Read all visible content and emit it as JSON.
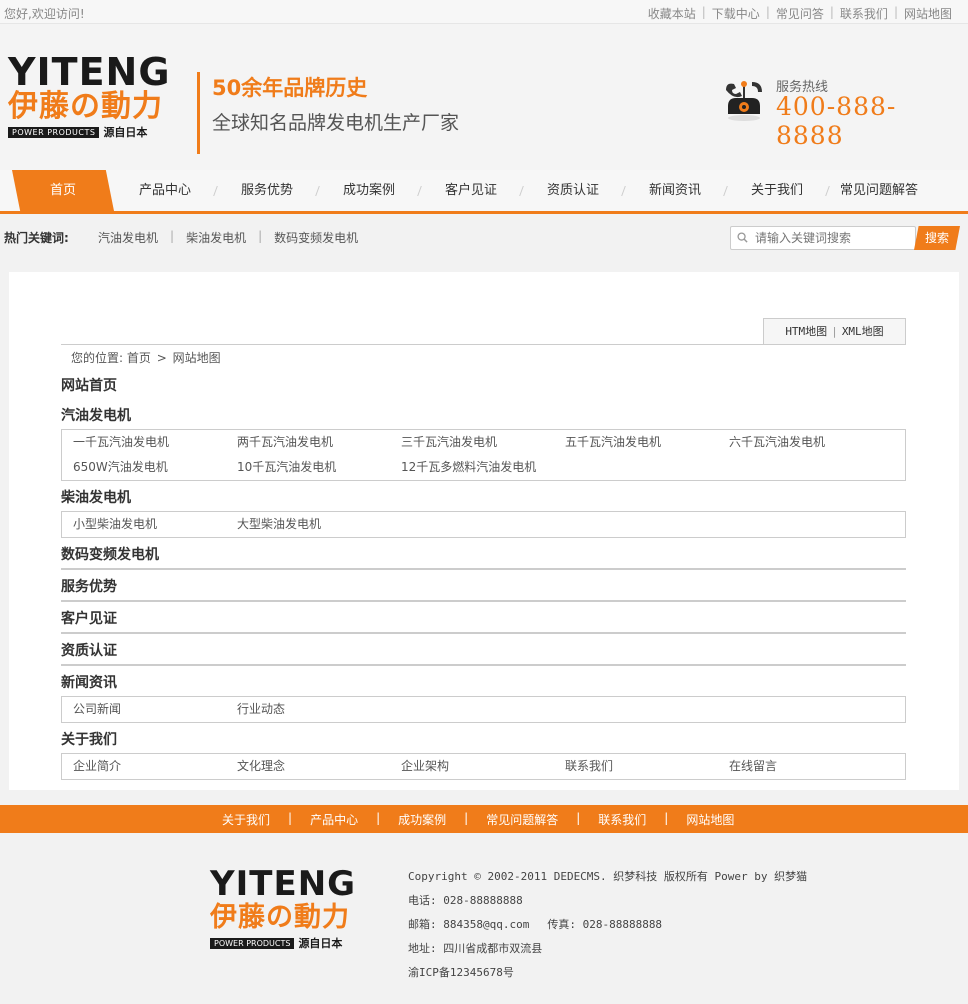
{
  "topbar": {
    "welcome": "您好,欢迎访问!",
    "links": [
      "收藏本站",
      "下载中心",
      "常见问答",
      "联系我们",
      "网站地图"
    ]
  },
  "brand": {
    "line1": "YITENG",
    "line2": "伊藤の動力",
    "power_products": "POWER PRODUCTS",
    "origin": "源自日本",
    "primary_color": "#f07c1a"
  },
  "slogan": {
    "line1": "50余年品牌历史",
    "line2": "全球知名品牌发电机生产厂家"
  },
  "hotline": {
    "label": "服务热线",
    "number": "400-888-8888",
    "icon": "telephone-icon"
  },
  "nav": {
    "items": [
      "首页",
      "产品中心",
      "服务优势",
      "成功案例",
      "客户见证",
      "资质认证",
      "新闻资讯",
      "关于我们",
      "常见问题解答"
    ],
    "active_index": 0
  },
  "keywords": {
    "title": "热门关键词:",
    "words": [
      "汽油发电机",
      "柴油发电机",
      "数码变频发电机"
    ]
  },
  "search": {
    "placeholder": "请输入关键词搜索",
    "button": "搜索"
  },
  "map_buttons": [
    "HTM地图",
    "XML地图"
  ],
  "breadcrumb": {
    "prefix": "您的位置:",
    "home": "首页",
    "arrow": ">",
    "current": "网站地图"
  },
  "sitemap": {
    "home": "网站首页",
    "sections": [
      {
        "title": "汽油发电机",
        "links": [
          "一千瓦汽油发电机",
          "两千瓦汽油发电机",
          "三千瓦汽油发电机",
          "五千瓦汽油发电机",
          "六千瓦汽油发电机",
          "650W汽油发电机",
          "10千瓦汽油发电机",
          "12千瓦多燃料汽油发电机"
        ]
      },
      {
        "title": "柴油发电机",
        "links": [
          "小型柴油发电机",
          "大型柴油发电机"
        ]
      },
      {
        "title": "数码变频发电机",
        "links": []
      },
      {
        "title": "服务优势",
        "links": []
      },
      {
        "title": "客户见证",
        "links": []
      },
      {
        "title": "资质认证",
        "links": []
      },
      {
        "title": "新闻资讯",
        "links": [
          "公司新闻",
          "行业动态"
        ]
      },
      {
        "title": "关于我们",
        "links": [
          "企业简介",
          "文化理念",
          "企业架构",
          "联系我们",
          "在线留言"
        ]
      }
    ]
  },
  "footer_nav": [
    "关于我们",
    "产品中心",
    "成功案例",
    "常见问题解答",
    "联系我们",
    "网站地图"
  ],
  "footer": {
    "copyright": "Copyright © 2002-2011 DEDECMS. 织梦科技 版权所有 Power by 织梦猫",
    "phone": "电话: 028-88888888",
    "email": "邮箱: 884358@qq.com",
    "fax": "传真: 028-88888888",
    "address": "地址: 四川省成都市双流县",
    "icp": "渝ICP备12345678号"
  }
}
